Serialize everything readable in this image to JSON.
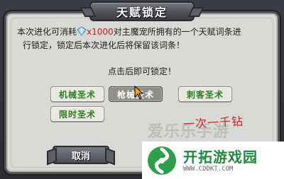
{
  "dialog": {
    "title": "天赋锁定",
    "desc_prefix": "本次进化可消耗",
    "cost_text": "x1000",
    "desc_suffix": "对主魔宠所拥有的一个天赋词条进",
    "desc_line2": "行锁定，锁定后本次进化后将保留该词条！",
    "tap_hint": "点击后即可锁定！",
    "cancel_label": "取消",
    "cost_icon": "diamond-gem-icon",
    "accent_color": "#2e7d1f",
    "cost_color": "#cc1a1a"
  },
  "options": [
    {
      "label": "机械圣术",
      "selected": false
    },
    {
      "label": "枪械圣术",
      "selected": true
    },
    {
      "label": "刺客圣术",
      "selected": false
    },
    {
      "label": "限时圣术",
      "selected": false
    }
  ],
  "annotation": "一次一千钻",
  "watermark": "爱乐乐手游",
  "brand": {
    "name": "开拓游戏园",
    "url": "WWW.CDDKT.COM"
  }
}
